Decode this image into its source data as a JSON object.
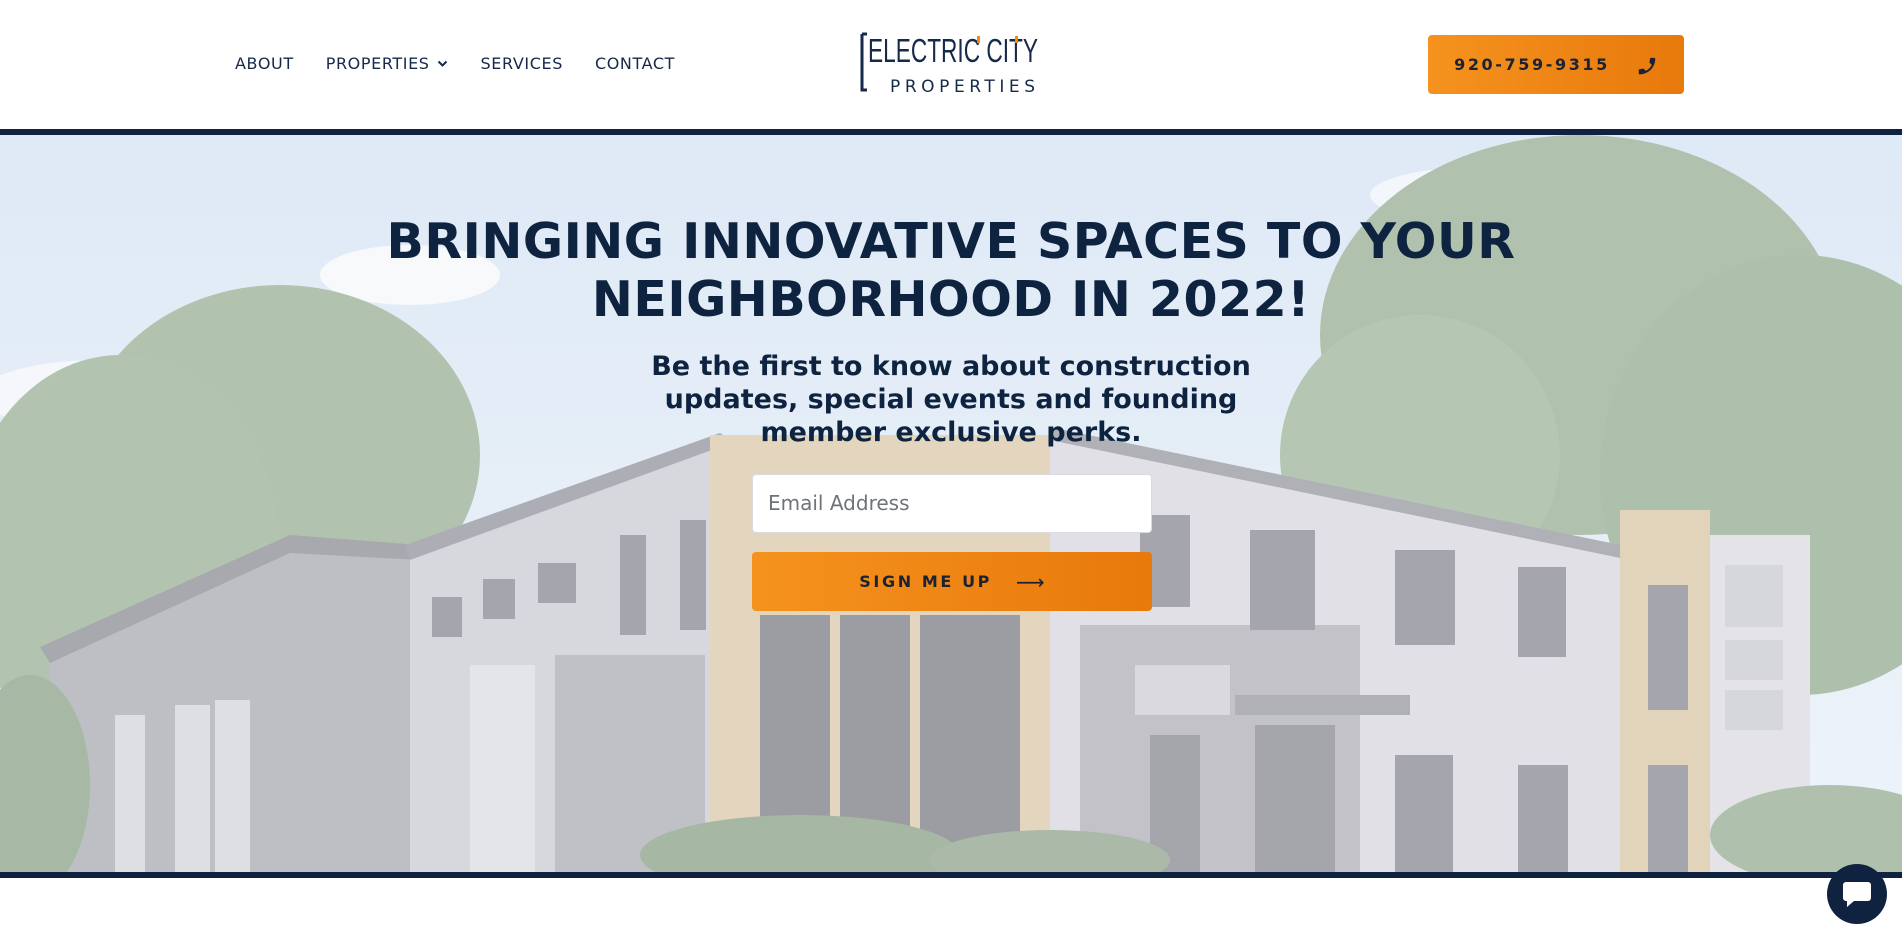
{
  "nav": {
    "items": [
      {
        "label": "ABOUT"
      },
      {
        "label": "PROPERTIES"
      },
      {
        "label": "SERVICES"
      },
      {
        "label": "CONTACT"
      }
    ]
  },
  "logo": {
    "line1": "ELECTRIC CITY",
    "line2": "PROPERTIES"
  },
  "header": {
    "phone": "920-759-9315",
    "phone_icon": "phone-icon"
  },
  "hero": {
    "headline_line1": "BRINGING INNOVATIVE SPACES TO YOUR",
    "headline_line2": "NEIGHBORHOOD IN 2022!",
    "subhead": "Be the first to know about construction updates, special events and founding member exclusive perks.",
    "email_placeholder": "Email Address",
    "signup_label": "SIGN ME UP",
    "signup_arrow": "⟶"
  },
  "chat": {
    "icon": "chat-icon"
  },
  "colors": {
    "navy": "#0f2341",
    "orange": "#f08a17",
    "text": "#0d2340"
  }
}
